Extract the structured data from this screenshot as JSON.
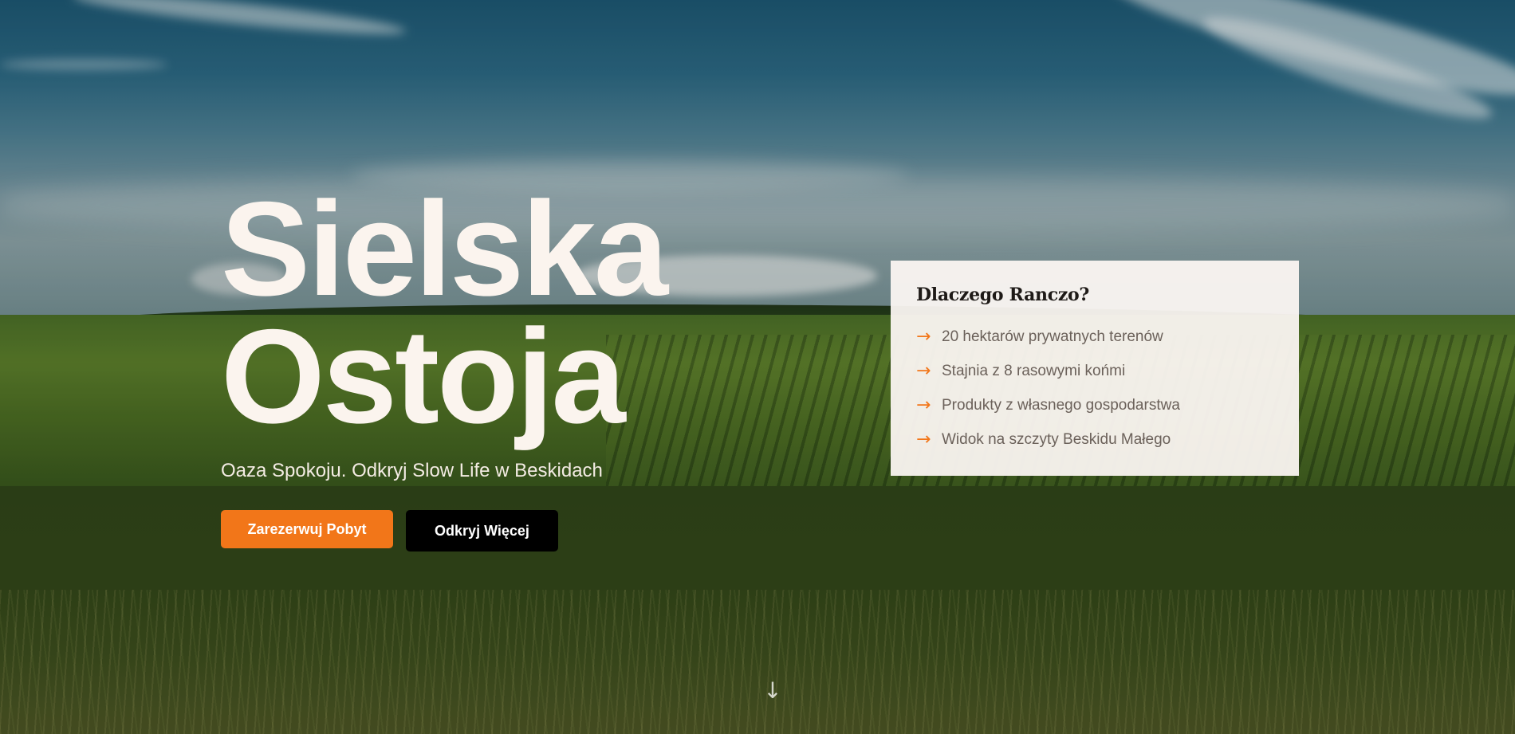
{
  "hero": {
    "title_line1": "Sielska",
    "title_line2": "Ostoja",
    "subtitle": "Oaza Spokoju. Odkryj Slow Life w Beskidach",
    "primary_button": "Zarezerwuj Pobyt",
    "secondary_button": "Odkryj Więcej",
    "scroll_icon": "arrow-down-icon"
  },
  "info_card": {
    "title": "Dlaczego Ranczo?",
    "bullet_icon": "arrow-right-icon",
    "items": [
      "20 hektarów prywatnych terenów",
      "Stajnia z 8 rasowymi końmi",
      "Produkty z własnego gospodarstwa",
      "Widok na szczyty Beskidu Małego"
    ]
  },
  "colors": {
    "accent": "#f27619",
    "text_light": "#fbf4ee",
    "card_bg": "#fcf7f3",
    "secondary_button_bg": "#000000"
  }
}
